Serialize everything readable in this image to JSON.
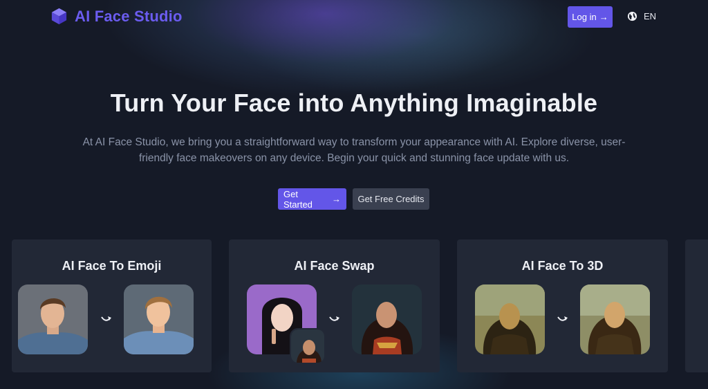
{
  "header": {
    "brand": "AI Face Studio",
    "login_label": "Log in",
    "login_arrow": "→",
    "language": "EN"
  },
  "hero": {
    "title": "Turn Your Face into Anything Imaginable",
    "description_line1": "At AI Face Studio, we bring you a straightforward way to transform your appearance with AI. Explore diverse, user-",
    "description_line2": "friendly face makeovers on any device. Begin your quick and stunning face update with us.",
    "get_started_label": "Get Started",
    "get_started_arrow": "→",
    "free_credits_label": "Get Free Credits"
  },
  "cards": [
    {
      "title": "AI Face To Emoji"
    },
    {
      "title": "AI Face Swap"
    },
    {
      "title": "AI Face To 3D"
    }
  ],
  "colors": {
    "accent": "#6356e8",
    "brand": "#6b5cf0",
    "background": "#151a27",
    "card": "#222836"
  },
  "icons": [
    "cube-logo-icon",
    "arrow-right-icon",
    "globe-icon",
    "curved-arrow-icon"
  ]
}
